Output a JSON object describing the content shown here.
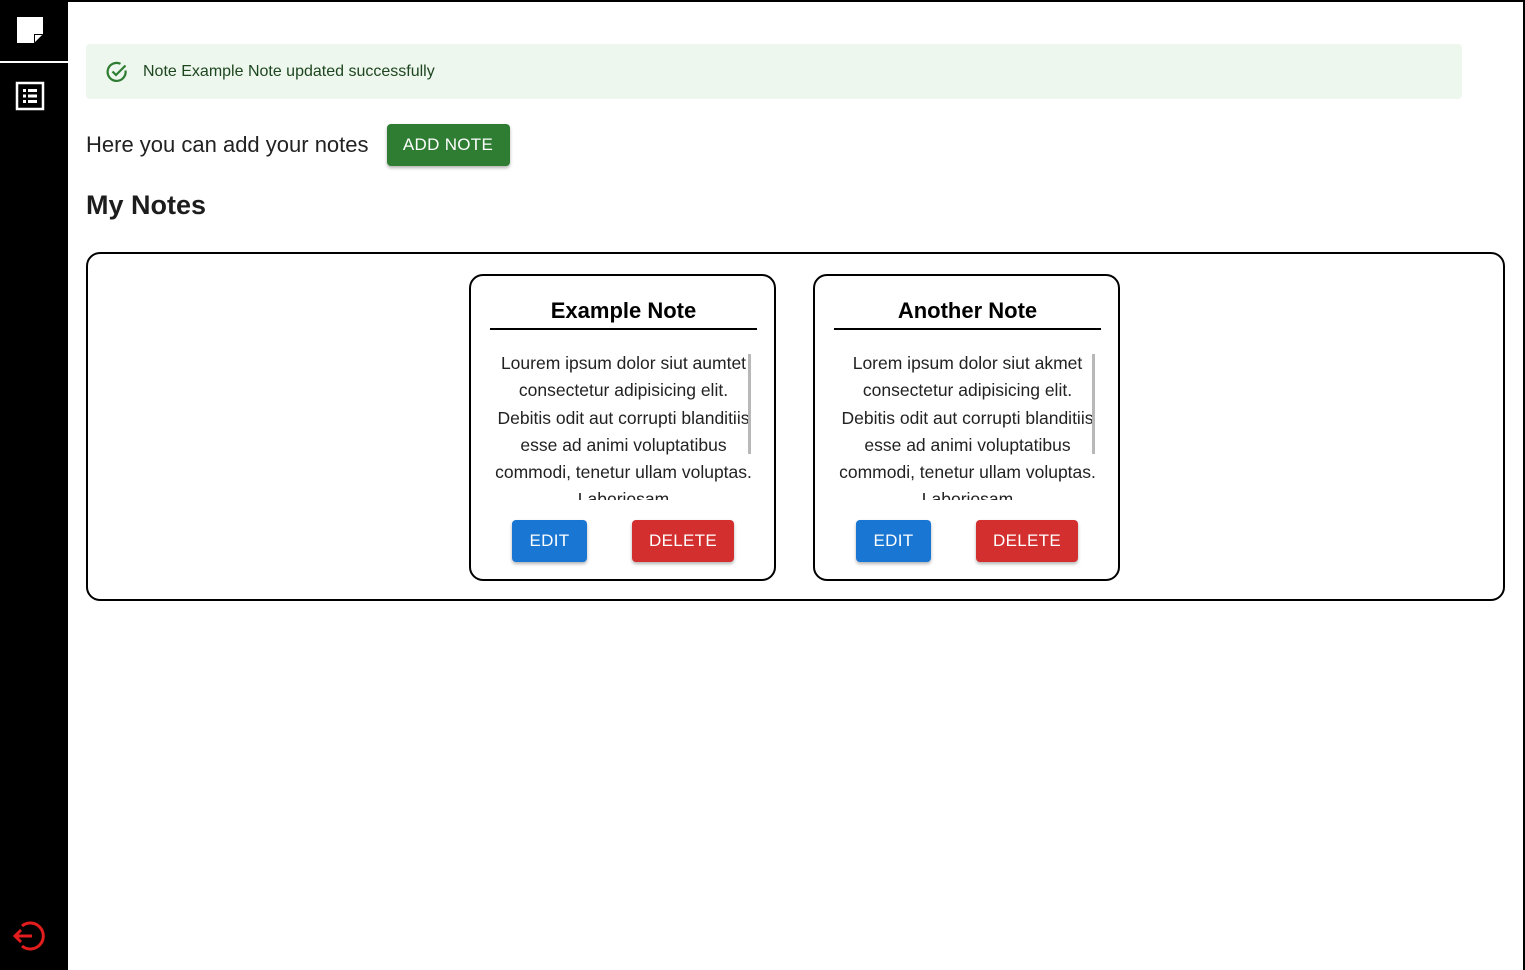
{
  "sidebar": {
    "items": [
      {
        "icon": "sticky-note-icon",
        "name": "notes"
      },
      {
        "icon": "list-icon",
        "name": "note-list"
      }
    ],
    "logout_icon": "logout-icon",
    "logout_color": "#e31d1d"
  },
  "alert": {
    "message": "Note Example Note updated successfully",
    "icon": "check-circle-icon",
    "color": "#2e7d32"
  },
  "intro": {
    "text": "Here you can add your notes",
    "add_label": "ADD NOTE"
  },
  "section": {
    "title": "My Notes"
  },
  "notes": [
    {
      "title": "Example Note",
      "body": "Lourem ipsum dolor siut aumtet consectetur adipisicing elit. Debitis odit aut corrupti blanditiis esse ad animi voluptatibus commodi, tenetur ullam voluptas. Laboriosam",
      "edit_label": "EDIT",
      "delete_label": "DELETE"
    },
    {
      "title": "Another Note",
      "body": "Lorem ipsum dolor siut akmet consectetur adipisicing elit. Debitis odit aut corrupti blanditiis esse ad animi voluptatibus commodi, tenetur ullam voluptas. Laboriosam",
      "edit_label": "EDIT",
      "delete_label": "DELETE"
    }
  ],
  "colors": {
    "add": "#2e7d32",
    "edit": "#1976d2",
    "delete": "#d32f2f",
    "alert_bg": "#edf7ed"
  }
}
